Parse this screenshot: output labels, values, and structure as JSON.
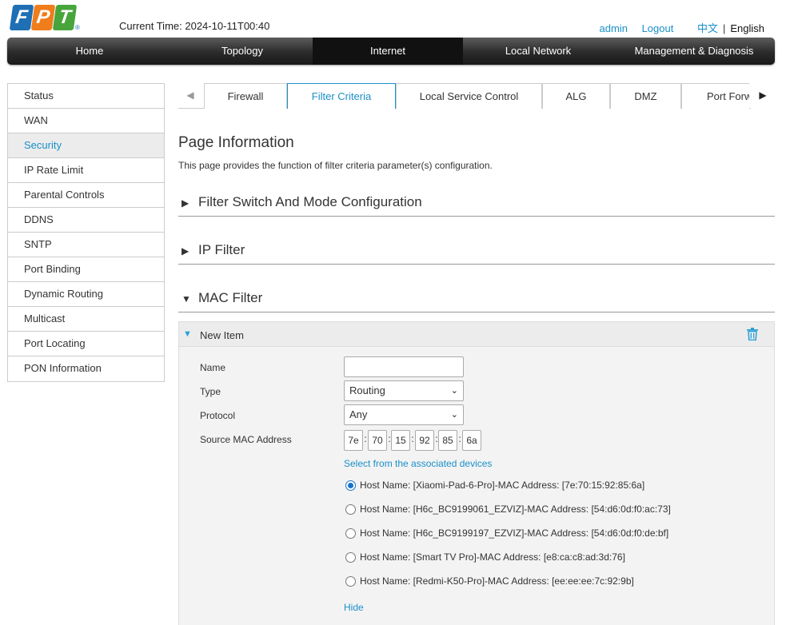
{
  "header": {
    "brand_letters": [
      "F",
      "P",
      "T"
    ],
    "brand_registered": "®",
    "current_time": "Current Time: 2024-10-11T00:40",
    "user": "admin",
    "logout": "Logout",
    "lang_zh": "中文",
    "lang_sep": "|",
    "lang_en": "English"
  },
  "main_nav": [
    "Home",
    "Topology",
    "Internet",
    "Local Network",
    "Management & Diagnosis"
  ],
  "main_nav_active": "Internet",
  "sidebar": [
    "Status",
    "WAN",
    "Security",
    "IP Rate Limit",
    "Parental Controls",
    "DDNS",
    "SNTP",
    "Port Binding",
    "Dynamic Routing",
    "Multicast",
    "Port Locating",
    "PON Information"
  ],
  "sidebar_active": "Security",
  "subtabs": {
    "left_arrow": "◀",
    "right_arrow": "▶",
    "items": [
      "Firewall",
      "Filter Criteria",
      "Local Service Control",
      "ALG",
      "DMZ",
      "Port Forwarding"
    ],
    "active": "Filter Criteria"
  },
  "page": {
    "title": "Page Information",
    "description": "This page provides the function of filter criteria parameter(s) configuration."
  },
  "sections": {
    "filter_switch": {
      "title": "Filter Switch And Mode Configuration",
      "caret": "▶"
    },
    "ip_filter": {
      "title": "IP Filter",
      "caret": "▶"
    },
    "mac_filter": {
      "title": "MAC Filter",
      "caret": "▼"
    }
  },
  "item": {
    "caret": "▼",
    "title": "New Item",
    "labels": {
      "name": "Name",
      "type": "Type",
      "protocol": "Protocol",
      "source_mac": "Source MAC Address"
    },
    "name_value": "",
    "type_value": "Routing",
    "protocol_value": "Any",
    "chevron": "⌄",
    "mac_segments": [
      "7e",
      "70",
      "15",
      "92",
      "85",
      "6a"
    ],
    "mac_colon": ":",
    "assoc_link": "Select from the associated devices",
    "hosts": [
      {
        "text": "Host Name: [Xiaomi-Pad-6-Pro]-MAC Address: [7e:70:15:92:85:6a]",
        "selected": true
      },
      {
        "text": "Host Name: [H6c_BC9199061_EZVIZ]-MAC Address: [54:d6:0d:f0:ac:73]",
        "selected": false
      },
      {
        "text": "Host Name: [H6c_BC9199197_EZVIZ]-MAC Address: [54:d6:0d:f0:de:bf]",
        "selected": false
      },
      {
        "text": "Host Name: [Smart TV Pro]-MAC Address: [e8:ca:c8:ad:3d:76]",
        "selected": false
      },
      {
        "text": "Host Name: [Redmi-K50-Pro]-MAC Address: [ee:ee:ee:7c:92:9b]",
        "selected": false
      }
    ],
    "hide_link": "Hide"
  },
  "colors": {
    "accent": "#1a90c9",
    "brand_blue": "#1f6fb5",
    "brand_orange": "#ef7d1b",
    "brand_green": "#48a53b",
    "nav_dark": "#1a1a1a"
  }
}
